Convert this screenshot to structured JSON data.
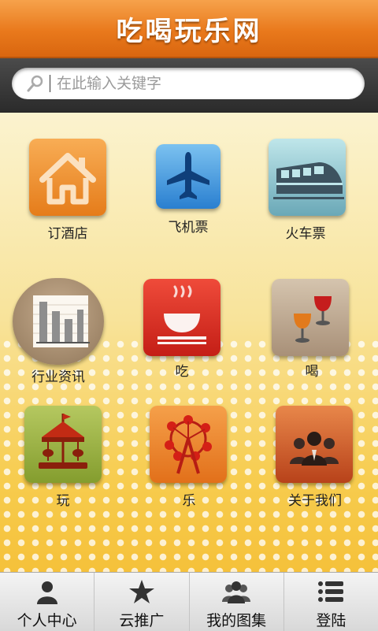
{
  "header": {
    "title": "吃喝玩乐网"
  },
  "search": {
    "placeholder": "在此输入关键字"
  },
  "grid": {
    "hotel": "订酒店",
    "flight": "飞机票",
    "train": "火车票",
    "news": "行业资讯",
    "eat": "吃",
    "drink": "喝",
    "play": "玩",
    "fun": "乐",
    "about": "关于我们"
  },
  "nav": {
    "profile": "个人中心",
    "promo": "云推广",
    "gallery": "我的图集",
    "login": "登陆"
  }
}
